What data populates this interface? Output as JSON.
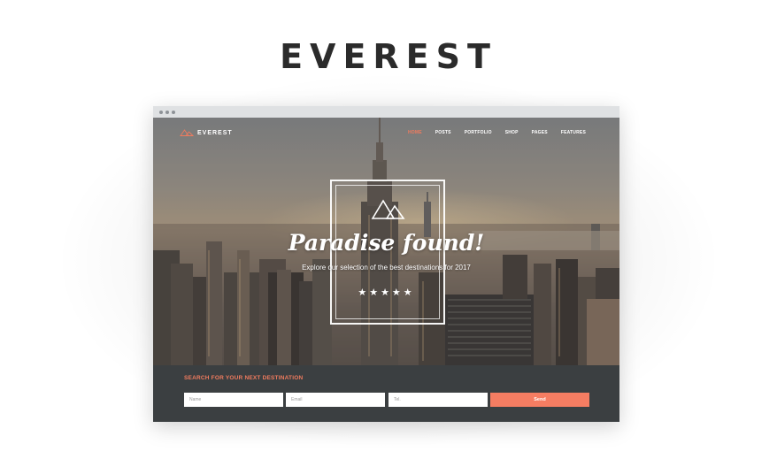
{
  "page": {
    "title": "EVEREST"
  },
  "site": {
    "logo_text": "EVEREST",
    "nav": [
      {
        "label": "HOME",
        "active": true
      },
      {
        "label": "POSTS",
        "active": false
      },
      {
        "label": "PORTFOLIO",
        "active": false
      },
      {
        "label": "SHOP",
        "active": false
      },
      {
        "label": "PAGES",
        "active": false
      },
      {
        "label": "FEATURES",
        "active": false
      }
    ],
    "hero": {
      "heading": "Paradise found!",
      "subheading": "Explore our selection of the best destinations for 2017",
      "stars": "★★★★★",
      "rating": 5
    },
    "search": {
      "title": "SEARCH FOR YOUR NEXT DESTINATION",
      "name_placeholder": "Name",
      "email_placeholder": "Email",
      "tel_placeholder": "Tel.",
      "send_label": "Send"
    }
  },
  "colors": {
    "accent": "#f07b5e",
    "button": "#f57d62",
    "panel": "#3b3f41",
    "title": "#2b2b2b"
  },
  "icons": [
    "mountain-logo-icon",
    "mountain-emblem-icon",
    "star-icon"
  ]
}
